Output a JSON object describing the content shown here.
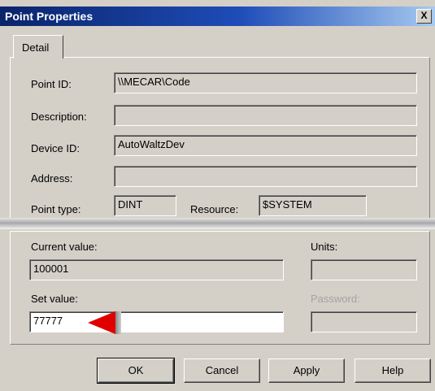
{
  "window": {
    "title": "Point Properties",
    "close_label": "X"
  },
  "tabs": [
    {
      "label": "Detail"
    }
  ],
  "detail": {
    "point_id_label": "Point ID:",
    "point_id_value": "\\\\MECAR\\Code",
    "description_label": "Description:",
    "description_value": "",
    "device_id_label": "Device ID:",
    "device_id_value": "AutoWaltzDev",
    "address_label": "Address:",
    "address_value": "",
    "point_type_label": "Point type:",
    "point_type_value": "DINT",
    "resource_label": "Resource:",
    "resource_value": "$SYSTEM"
  },
  "values": {
    "current_value_label": "Current value:",
    "current_value": "100001",
    "units_label": "Units:",
    "units_value": "",
    "set_value_label": "Set value:",
    "set_value": "77777",
    "password_label": "Password:",
    "password_value": ""
  },
  "annotation": {
    "arrow_color": "#e00000"
  },
  "buttons": {
    "ok": "OK",
    "cancel": "Cancel",
    "apply": "Apply",
    "help": "Help"
  }
}
